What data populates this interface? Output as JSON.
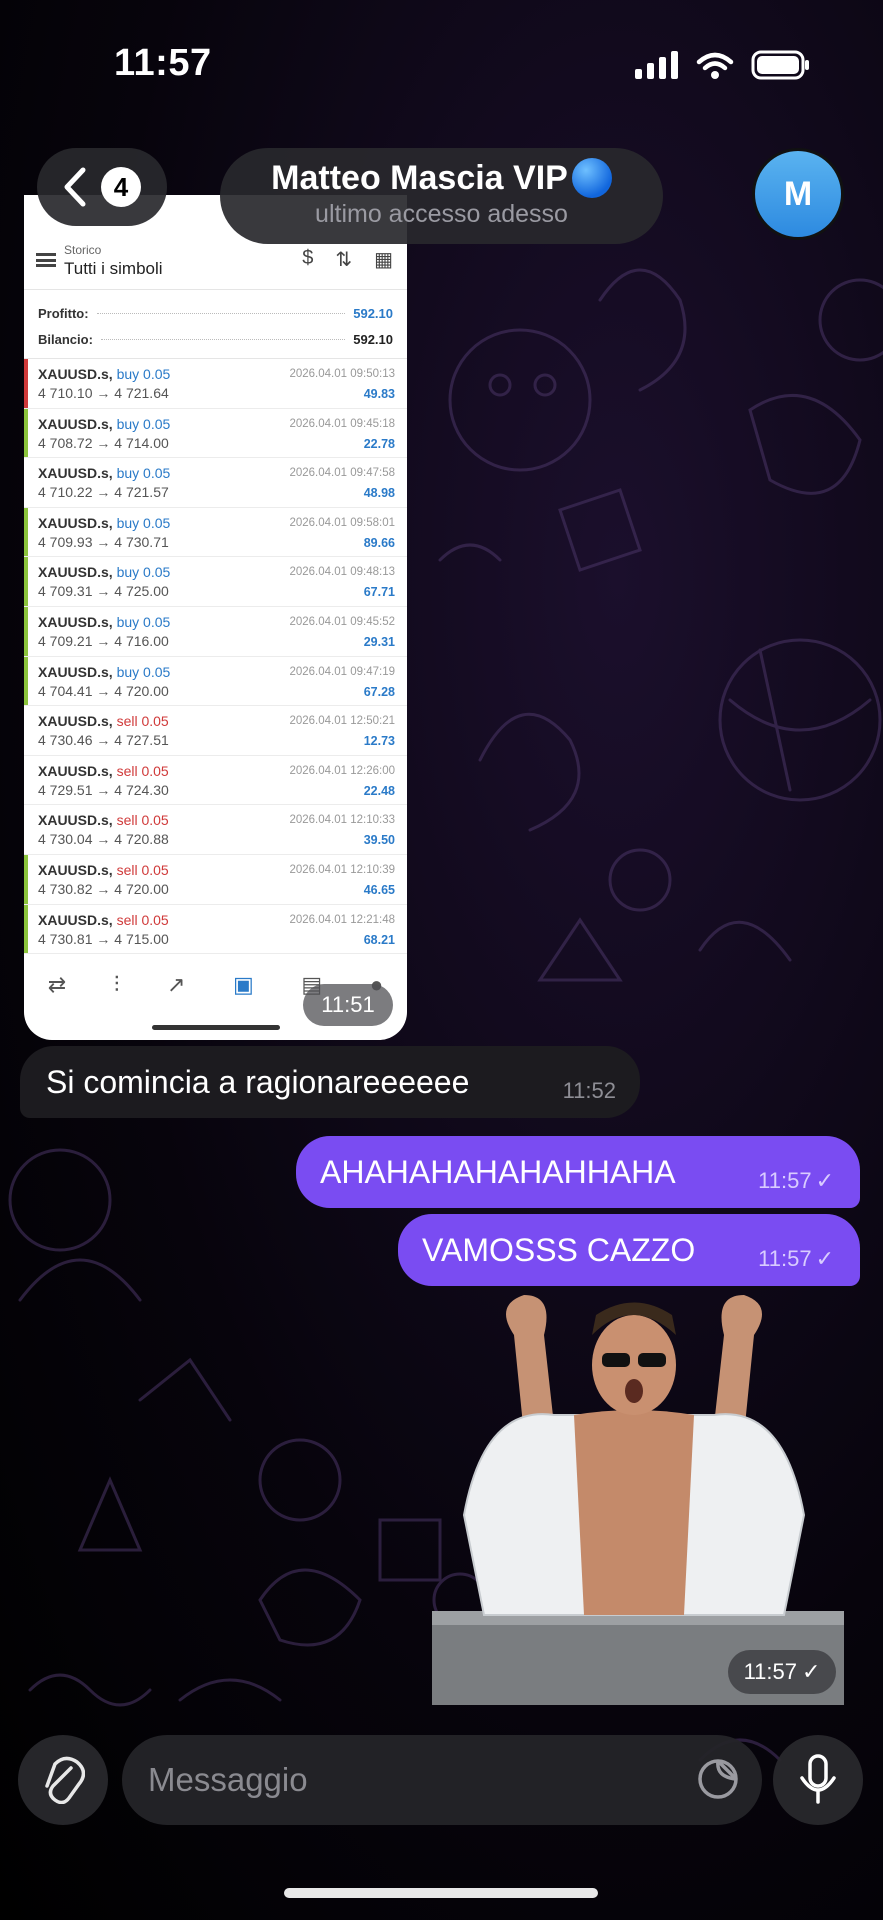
{
  "status_bar": {
    "time": "11:57"
  },
  "header": {
    "back_count": "4",
    "chat_name": "Matteo Mascia VIP",
    "chat_status": "ultimo accesso adesso",
    "avatar_initial": "M"
  },
  "screenshot_message": {
    "top_small": "Storico",
    "title": "Tutti i simboli",
    "summary": [
      {
        "label": "Profitto:",
        "value": "592.10",
        "color": "#2a7ac8"
      },
      {
        "label": "Bilancio:",
        "value": "592.10",
        "color": "#222222"
      }
    ],
    "deals": [
      {
        "symbol": "XAUUSD.s,",
        "side": "buy 0.05",
        "type": "buy",
        "prices": "4 710.10 → 4 721.64",
        "datetime": "2026.04.01 09:50:13",
        "profit": "49.83",
        "bar": "#d03a3a"
      },
      {
        "symbol": "XAUUSD.s,",
        "side": "buy 0.05",
        "type": "buy",
        "prices": "4 708.72 → 4 714.00",
        "datetime": "2026.04.01 09:45:18",
        "profit": "22.78",
        "bar": "#8cc43c"
      },
      {
        "symbol": "XAUUSD.s,",
        "side": "buy 0.05",
        "type": "buy",
        "prices": "4 710.22 → 4 721.57",
        "datetime": "2026.04.01 09:47:58",
        "profit": "48.98",
        "bar": "#ffffff"
      },
      {
        "symbol": "XAUUSD.s,",
        "side": "buy 0.05",
        "type": "buy",
        "prices": "4 709.93 → 4 730.71",
        "datetime": "2026.04.01 09:58:01",
        "profit": "89.66",
        "bar": "#8cc43c"
      },
      {
        "symbol": "XAUUSD.s,",
        "side": "buy 0.05",
        "type": "buy",
        "prices": "4 709.31 → 4 725.00",
        "datetime": "2026.04.01 09:48:13",
        "profit": "67.71",
        "bar": "#8cc43c"
      },
      {
        "symbol": "XAUUSD.s,",
        "side": "buy 0.05",
        "type": "buy",
        "prices": "4 709.21 → 4 716.00",
        "datetime": "2026.04.01 09:45:52",
        "profit": "29.31",
        "bar": "#8cc43c"
      },
      {
        "symbol": "XAUUSD.s,",
        "side": "buy 0.05",
        "type": "buy",
        "prices": "4 704.41 → 4 720.00",
        "datetime": "2026.04.01 09:47:19",
        "profit": "67.28",
        "bar": "#8cc43c"
      },
      {
        "symbol": "XAUUSD.s,",
        "side": "sell 0.05",
        "type": "sell",
        "prices": "4 730.46 → 4 727.51",
        "datetime": "2026.04.01 12:50:21",
        "profit": "12.73",
        "bar": "#ffffff"
      },
      {
        "symbol": "XAUUSD.s,",
        "side": "sell 0.05",
        "type": "sell",
        "prices": "4 729.51 → 4 724.30",
        "datetime": "2026.04.01 12:26:00",
        "profit": "22.48",
        "bar": "#ffffff"
      },
      {
        "symbol": "XAUUSD.s,",
        "side": "sell 0.05",
        "type": "sell",
        "prices": "4 730.04 → 4 720.88",
        "datetime": "2026.04.01 12:10:33",
        "profit": "39.50",
        "bar": "#ffffff"
      },
      {
        "symbol": "XAUUSD.s,",
        "side": "sell 0.05",
        "type": "sell",
        "prices": "4 730.82 → 4 720.00",
        "datetime": "2026.04.01 12:10:39",
        "profit": "46.65",
        "bar": "#8cc43c"
      },
      {
        "symbol": "XAUUSD.s,",
        "side": "sell 0.05",
        "type": "sell",
        "prices": "4 730.81 → 4 715.00",
        "datetime": "2026.04.01 12:21:48",
        "profit": "68.21",
        "bar": "#8cc43c"
      }
    ],
    "time": "11:51"
  },
  "messages": [
    {
      "text": "Si comincia a ragionareeeeee",
      "time": "11:52",
      "direction": "in"
    },
    {
      "text": "AHAHAHAHAHAHHAHA",
      "time": "11:57",
      "direction": "out"
    },
    {
      "text": "VAMOSSS CAZZO",
      "time": "11:57",
      "direction": "out"
    }
  ],
  "sticker": {
    "time": "11:57"
  },
  "composer": {
    "placeholder": "Messaggio"
  },
  "colors": {
    "accent": "#7a4cf2",
    "incoming": "#1c1b1f"
  }
}
